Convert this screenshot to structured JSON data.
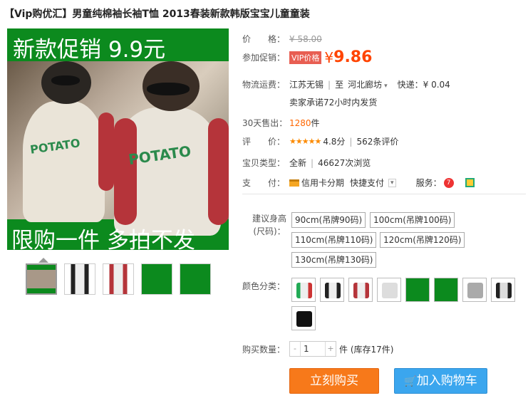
{
  "title": "【Vip购优汇】男童纯棉袖长袖T恤 2013春装新款韩版宝宝儿童童装",
  "image": {
    "top_text": "新款促销  9.9元",
    "bottom_text": "限购一件  多拍不发",
    "shirt_text": "POTATO"
  },
  "price": {
    "label": "价　　格：",
    "original": "¥ 58.00"
  },
  "promo": {
    "label": "参加促销：",
    "badge": "VIP价格",
    "yen": "¥",
    "price": "9.86"
  },
  "shipping": {
    "label": "物流运费：",
    "from": "江苏无锡",
    "to_prefix": "至",
    "to": "河北廊坊",
    "method": "快递：¥ 0.04",
    "promise": "卖家承诺72小时内发货"
  },
  "sales": {
    "label": "30天售出：",
    "count": "1280",
    "unit": "件"
  },
  "rating": {
    "label": "评　　价：",
    "stars": "★★★★★",
    "score": "4.8分",
    "reviews": "562条评价"
  },
  "type": {
    "label": "宝贝类型：",
    "value": "全新",
    "views": "46627次浏览"
  },
  "payment": {
    "label": "支　　付：",
    "credit": "信用卡分期",
    "quick": "快捷支付",
    "service_label": "服务："
  },
  "sizes": {
    "label": "建议身高(尺码)：",
    "options": [
      "90cm(吊牌90码)",
      "100cm(吊牌100码)",
      "110cm(吊牌110码)",
      "120cm(吊牌120码)",
      "130cm(吊牌130码)"
    ]
  },
  "colors": {
    "label": "颜色分类："
  },
  "quantity": {
    "label": "购买数量：",
    "minus": "-",
    "value": "1",
    "plus": "+",
    "stock": "件 (库存17件)"
  },
  "buttons": {
    "buy": "立刻购买",
    "cart": "加入购物车"
  },
  "colors_palette": {
    "accent": "#ff4400",
    "buy": "#f7791a",
    "cart": "#3ba6ee",
    "banner": "#0c8a1e"
  }
}
